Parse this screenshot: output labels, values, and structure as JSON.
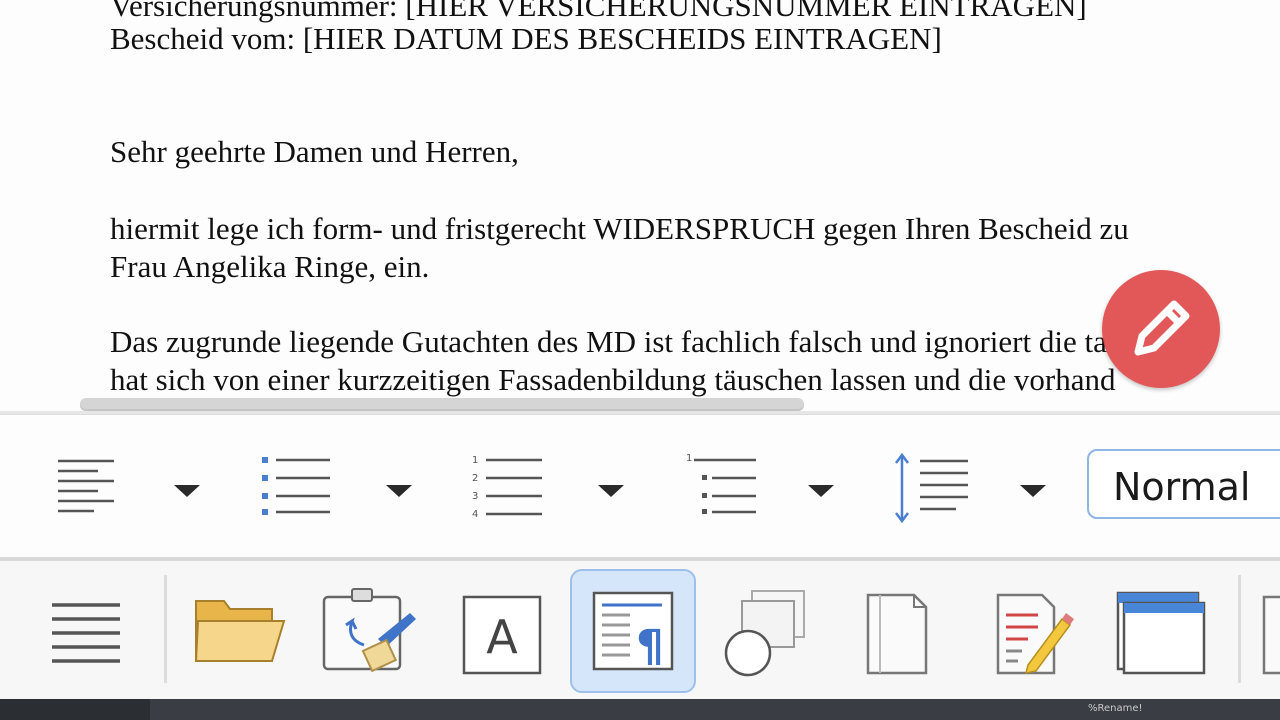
{
  "document": {
    "lines": [
      "Versicherungsnummer: [HIER VERSICHERUNGSNUMMER EINTRAGEN]",
      "Bescheid vom: [HIER DATUM DES BESCHEIDS EINTRAGEN]",
      "Sehr geehrte Damen und Herren,",
      "hiermit lege ich form- und fristgerecht WIDERSPRUCH gegen Ihren Bescheid zu",
      "Frau Angelika Ringe, ein.",
      "Das zugrunde liegende Gutachten des MD ist fachlich falsch und ignoriert die ta",
      "hat sich von einer kurzzeitigen Fassadenbildung täuschen lassen und die vorhand"
    ]
  },
  "edit_fab": {
    "icon": "pencil-icon",
    "color": "#e04a4a"
  },
  "format_toolbar": {
    "buttons": [
      {
        "icon": "align-left-icon"
      },
      {
        "icon": "bullet-list-icon"
      },
      {
        "icon": "numbered-list-icon"
      },
      {
        "icon": "outline-list-icon"
      },
      {
        "icon": "line-spacing-icon"
      }
    ],
    "paragraph_style": "Normal"
  },
  "tool_bar": {
    "tools": [
      {
        "icon": "menu-lines-icon"
      },
      {
        "icon": "folder-open-icon"
      },
      {
        "icon": "clone-formatting-icon"
      },
      {
        "icon": "text-frame-icon"
      },
      {
        "icon": "formatting-marks-icon",
        "active": true
      },
      {
        "icon": "shapes-icon"
      },
      {
        "icon": "page-icon"
      },
      {
        "icon": "edit-document-icon"
      },
      {
        "icon": "window-icon"
      }
    ]
  },
  "colors": {
    "accent": "#9dc0ea",
    "active_bg": "#d6e6fa",
    "fab": "#e04a4a"
  },
  "status": {
    "text": "%Rename!"
  }
}
